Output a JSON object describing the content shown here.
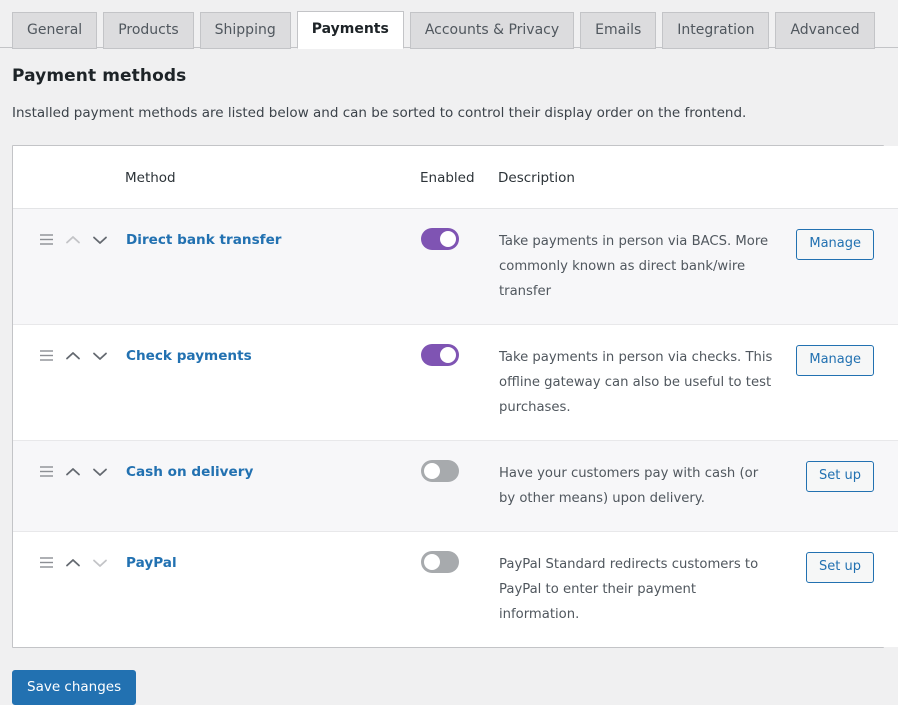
{
  "tabs": [
    {
      "label": "General",
      "active": false
    },
    {
      "label": "Products",
      "active": false
    },
    {
      "label": "Shipping",
      "active": false
    },
    {
      "label": "Payments",
      "active": true
    },
    {
      "label": "Accounts & Privacy",
      "active": false
    },
    {
      "label": "Emails",
      "active": false
    },
    {
      "label": "Integration",
      "active": false
    },
    {
      "label": "Advanced",
      "active": false
    }
  ],
  "page": {
    "title": "Payment methods",
    "description": "Installed payment methods are listed below and can be sorted to control their display order on the frontend."
  },
  "table": {
    "headers": {
      "sort": "",
      "method": "Method",
      "enabled": "Enabled",
      "description": "Description",
      "action": ""
    },
    "rows": [
      {
        "name": "Direct bank transfer",
        "enabled": true,
        "toggle_state": "on",
        "description": "Take payments in person via BACS. More commonly known as direct bank/wire transfer",
        "action_label": "Manage",
        "move_up_enabled": false,
        "move_down_enabled": true
      },
      {
        "name": "Check payments",
        "enabled": true,
        "toggle_state": "on",
        "description": "Take payments in person via checks. This offline gateway can also be useful to test purchases.",
        "action_label": "Manage",
        "move_up_enabled": true,
        "move_down_enabled": true
      },
      {
        "name": "Cash on delivery",
        "enabled": false,
        "toggle_state": "off",
        "description": "Have your customers pay with cash (or by other means) upon delivery.",
        "action_label": "Set up",
        "move_up_enabled": true,
        "move_down_enabled": true
      },
      {
        "name": "PayPal",
        "enabled": false,
        "toggle_state": "off",
        "description": "PayPal Standard redirects customers to PayPal to enter their payment information.",
        "action_label": "Set up",
        "move_up_enabled": true,
        "move_down_enabled": false
      }
    ]
  },
  "footer": {
    "save_label": "Save changes"
  },
  "colors": {
    "accent_blue": "#2271b1",
    "toggle_on_purple": "#7f54b3",
    "toggle_off_gray": "#a7aaad",
    "page_background": "#f0f0f1",
    "card_background": "#ffffff",
    "row_stripe": "#f7f7f9",
    "border": "#c3c4c7"
  },
  "icons": {
    "drag_handle": "drag-handle-icon",
    "move_up": "chevron-up-icon",
    "move_down": "chevron-down-icon"
  }
}
